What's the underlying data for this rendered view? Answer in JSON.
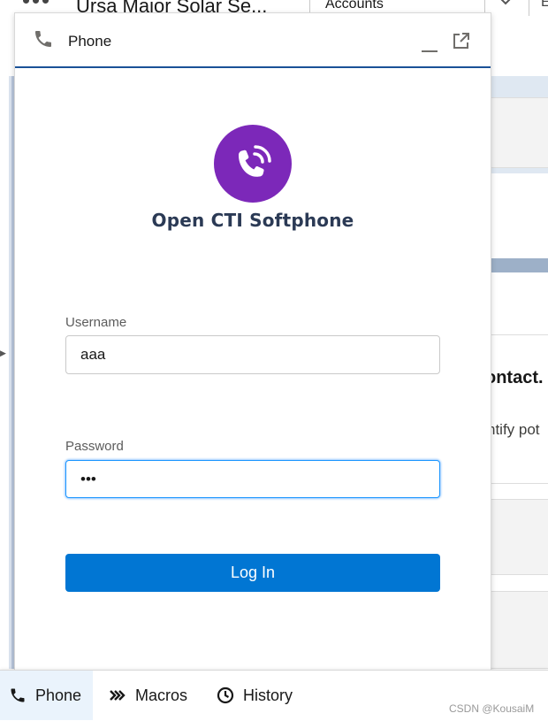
{
  "app": {
    "name": "Ursa Major Solar Se...",
    "nav_tab": "Accounts",
    "nav_extra": "E"
  },
  "background": {
    "card_heading": "ontact.",
    "card_text": "ntify pot"
  },
  "panel": {
    "title": "Phone",
    "icons": {
      "header": "phone-icon",
      "minimize": "minimize-icon",
      "popout": "popout-icon"
    }
  },
  "logo": {
    "text": "Open CTI  Softphone",
    "color": "#7c28b9",
    "icon": "phone-ringing-icon"
  },
  "form": {
    "username_label": "Username",
    "username_value": "aaa",
    "password_label": "Password",
    "password_value": "•••",
    "login_label": "Log In"
  },
  "colors": {
    "accent": "#0176d3",
    "header_rule": "#1b5297",
    "focus": "#1b96ff"
  },
  "utility_bar": {
    "items": [
      {
        "label": "Phone",
        "icon": "phone-icon",
        "active": true
      },
      {
        "label": "Macros",
        "icon": "macros-icon",
        "active": false
      },
      {
        "label": "History",
        "icon": "clock-icon",
        "active": false
      }
    ]
  },
  "watermark": "CSDN @KousaiM"
}
